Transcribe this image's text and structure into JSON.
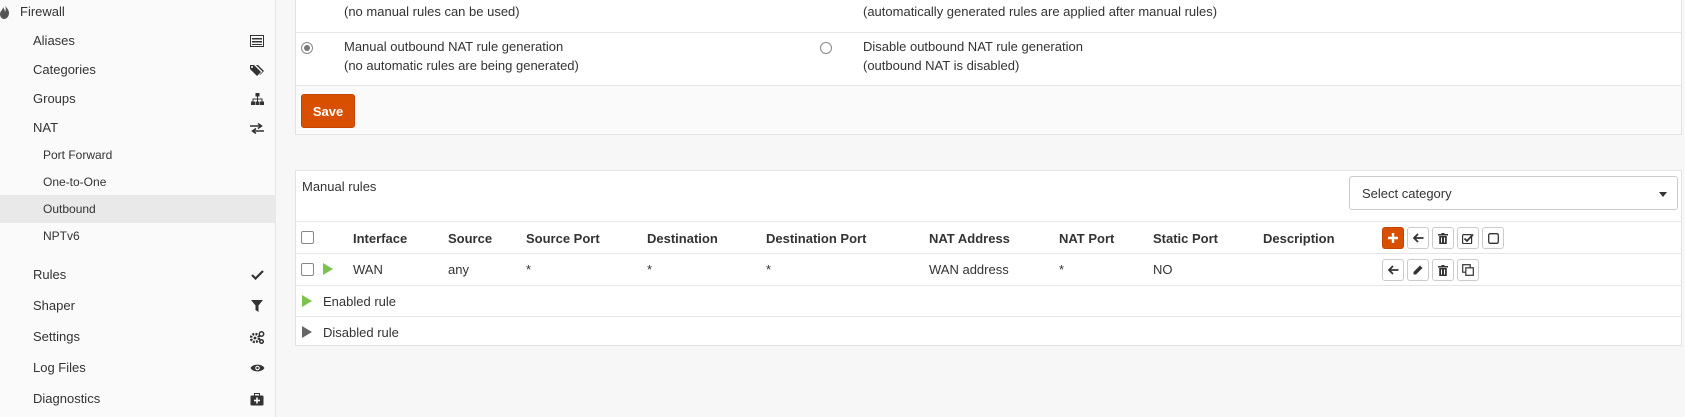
{
  "sidebar": {
    "header": "Firewall",
    "items": [
      {
        "label": "Aliases",
        "icon": "list-icon"
      },
      {
        "label": "Categories",
        "icon": "tags-icon"
      },
      {
        "label": "Groups",
        "icon": "sitemap-icon"
      },
      {
        "label": "NAT",
        "icon": "exchange-icon"
      },
      {
        "label": "Rules",
        "icon": "check-icon"
      },
      {
        "label": "Shaper",
        "icon": "filter-icon"
      },
      {
        "label": "Settings",
        "icon": "cogs-icon"
      },
      {
        "label": "Log Files",
        "icon": "eye-icon"
      },
      {
        "label": "Diagnostics",
        "icon": "medkit-icon"
      }
    ],
    "nat_sub": [
      {
        "label": "Port Forward"
      },
      {
        "label": "One-to-One"
      },
      {
        "label": "Outbound",
        "active": true
      },
      {
        "label": "NPTv6"
      }
    ]
  },
  "mode": {
    "top_left_line2": "(no manual rules can be used)",
    "top_right_line2": "(automatically generated rules are applied after manual rules)",
    "manual_title": "Manual outbound NAT rule generation",
    "manual_desc": "(no automatic rules are being generated)",
    "disable_title": "Disable outbound NAT rule generation",
    "disable_desc": "(outbound NAT is disabled)",
    "selected": "manual",
    "save_label": "Save"
  },
  "rules": {
    "title": "Manual rules",
    "category_select": "Select category",
    "columns": [
      "Interface",
      "Source",
      "Source Port",
      "Destination",
      "Destination Port",
      "NAT Address",
      "NAT Port",
      "Static Port",
      "Description"
    ],
    "rows": [
      {
        "interface": "WAN",
        "source": "any",
        "source_port": "*",
        "destination": "*",
        "destination_port": "*",
        "nat_address": "WAN address",
        "nat_port": "*",
        "static_port": "NO",
        "description": "",
        "enabled": true
      }
    ],
    "legend": {
      "enabled": "Enabled rule",
      "disabled": "Disabled rule"
    }
  },
  "colors": {
    "accent": "#d94f00",
    "enabled": "#7cc24d",
    "disabled": "#666666"
  }
}
